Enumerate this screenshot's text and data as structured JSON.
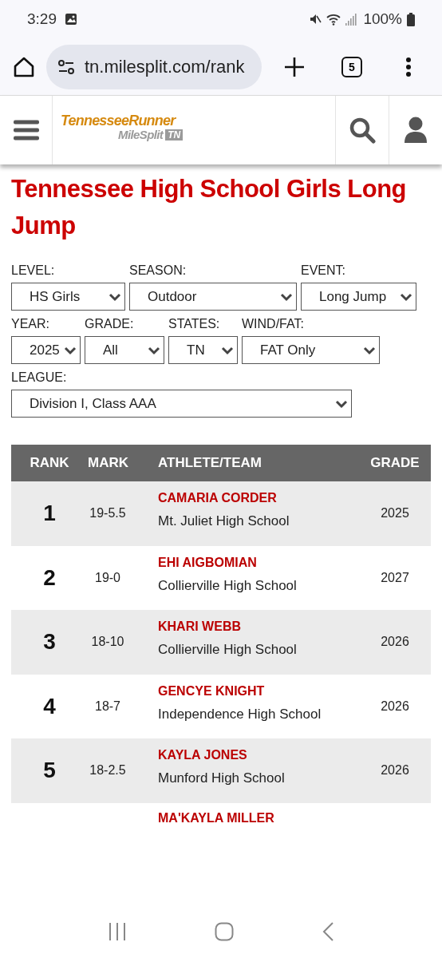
{
  "status_bar": {
    "time": "3:29",
    "battery": "100%"
  },
  "browser": {
    "url": "tn.milesplit.com/rank",
    "tab_count": "5"
  },
  "site_header": {
    "logo_top": "TennesseeRunner",
    "logo_bottom": "MileSplit",
    "logo_badge": "TN"
  },
  "title": "Tennessee High School Girls Long Jump",
  "filters": [
    {
      "label": "LEVEL:",
      "value": "HS Girls"
    },
    {
      "label": "SEASON:",
      "value": "Outdoor"
    },
    {
      "label": "EVENT:",
      "value": "Long Jump"
    },
    {
      "label": "YEAR:",
      "value": "2025"
    },
    {
      "label": "GRADE:",
      "value": "All"
    },
    {
      "label": "STATES:",
      "value": "TN"
    },
    {
      "label": "WIND/FAT:",
      "value": "FAT Only"
    },
    {
      "label": "LEAGUE:",
      "value": "Division I, Class AAA"
    }
  ],
  "table": {
    "columns": [
      "RANK",
      "MARK",
      "ATHLETE/TEAM",
      "GRADE"
    ],
    "rows": [
      {
        "rank": "1",
        "mark": "19-5.5",
        "athlete": "CAMARIA CORDER",
        "team": "Mt. Juliet High School",
        "grade": "2025"
      },
      {
        "rank": "2",
        "mark": "19-0",
        "athlete": "EHI AIGBOMIAN",
        "team": "Collierville High School",
        "grade": "2027"
      },
      {
        "rank": "3",
        "mark": "18-10",
        "athlete": "KHARI WEBB",
        "team": "Collierville High School",
        "grade": "2026"
      },
      {
        "rank": "4",
        "mark": "18-7",
        "athlete": "GENCYE KNIGHT",
        "team": "Independence High School",
        "grade": "2026"
      },
      {
        "rank": "5",
        "mark": "18-2.5",
        "athlete": "KAYLA JONES",
        "team": "Munford High School",
        "grade": "2026"
      },
      {
        "athlete": "MA'KAYLA MILLER"
      }
    ]
  }
}
